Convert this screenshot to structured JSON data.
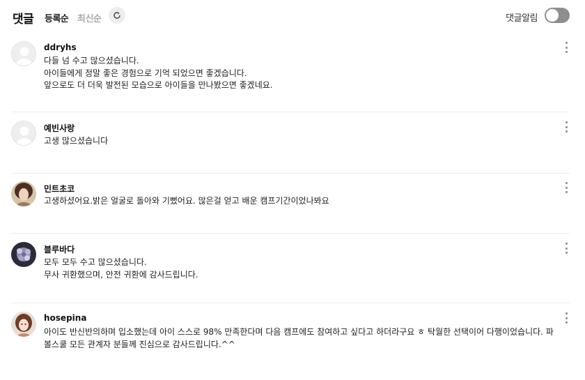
{
  "header": {
    "title": "댓글",
    "sort_latest_registered": "등록순",
    "sort_newest": "최신순",
    "refresh_icon": "refresh-icon",
    "notify_label": "댓글알림",
    "notify_enabled": false
  },
  "comments": [
    {
      "author": "ddryhs",
      "avatar": "default-avatar",
      "text": "다들 넘 수고 많으셨습니다.\n아이들에게 정말 좋은 경험으로 기억 되었으면 좋겠습니다.\n앞으로도 더 더욱 발전된 모습으로 아이들을 만나봤으면 좋겠네요."
    },
    {
      "author": "예빈사랑",
      "avatar": "default-avatar",
      "text": "고생 많으셨습니다"
    },
    {
      "author": "민트초코",
      "avatar": "photo-avatar",
      "text": "고생하셨어요.밝은 얼굴로 돌아와 기뻤어요. 많은걸 얻고 배운 캠프기간이었나봐요"
    },
    {
      "author": "블루바다",
      "avatar": "photo-avatar",
      "text": "모두 모두 수고 많으셨습니다.\n무사 귀환했으며, 안전 귀환에 감사드립니다."
    },
    {
      "author": "hosepina",
      "avatar": "photo-avatar",
      "text": "아이도 반신반의하며 입소했는데 아이 스스로 98% 만족한다며 다음 캠프에도 참여하고 싶다고 하더라구요 ㅎ 탁월한 선택이어 다행이었습니다. 파볼스쿨 모든 관계자 분들께 진심으로 감사드립니다.^^"
    }
  ]
}
